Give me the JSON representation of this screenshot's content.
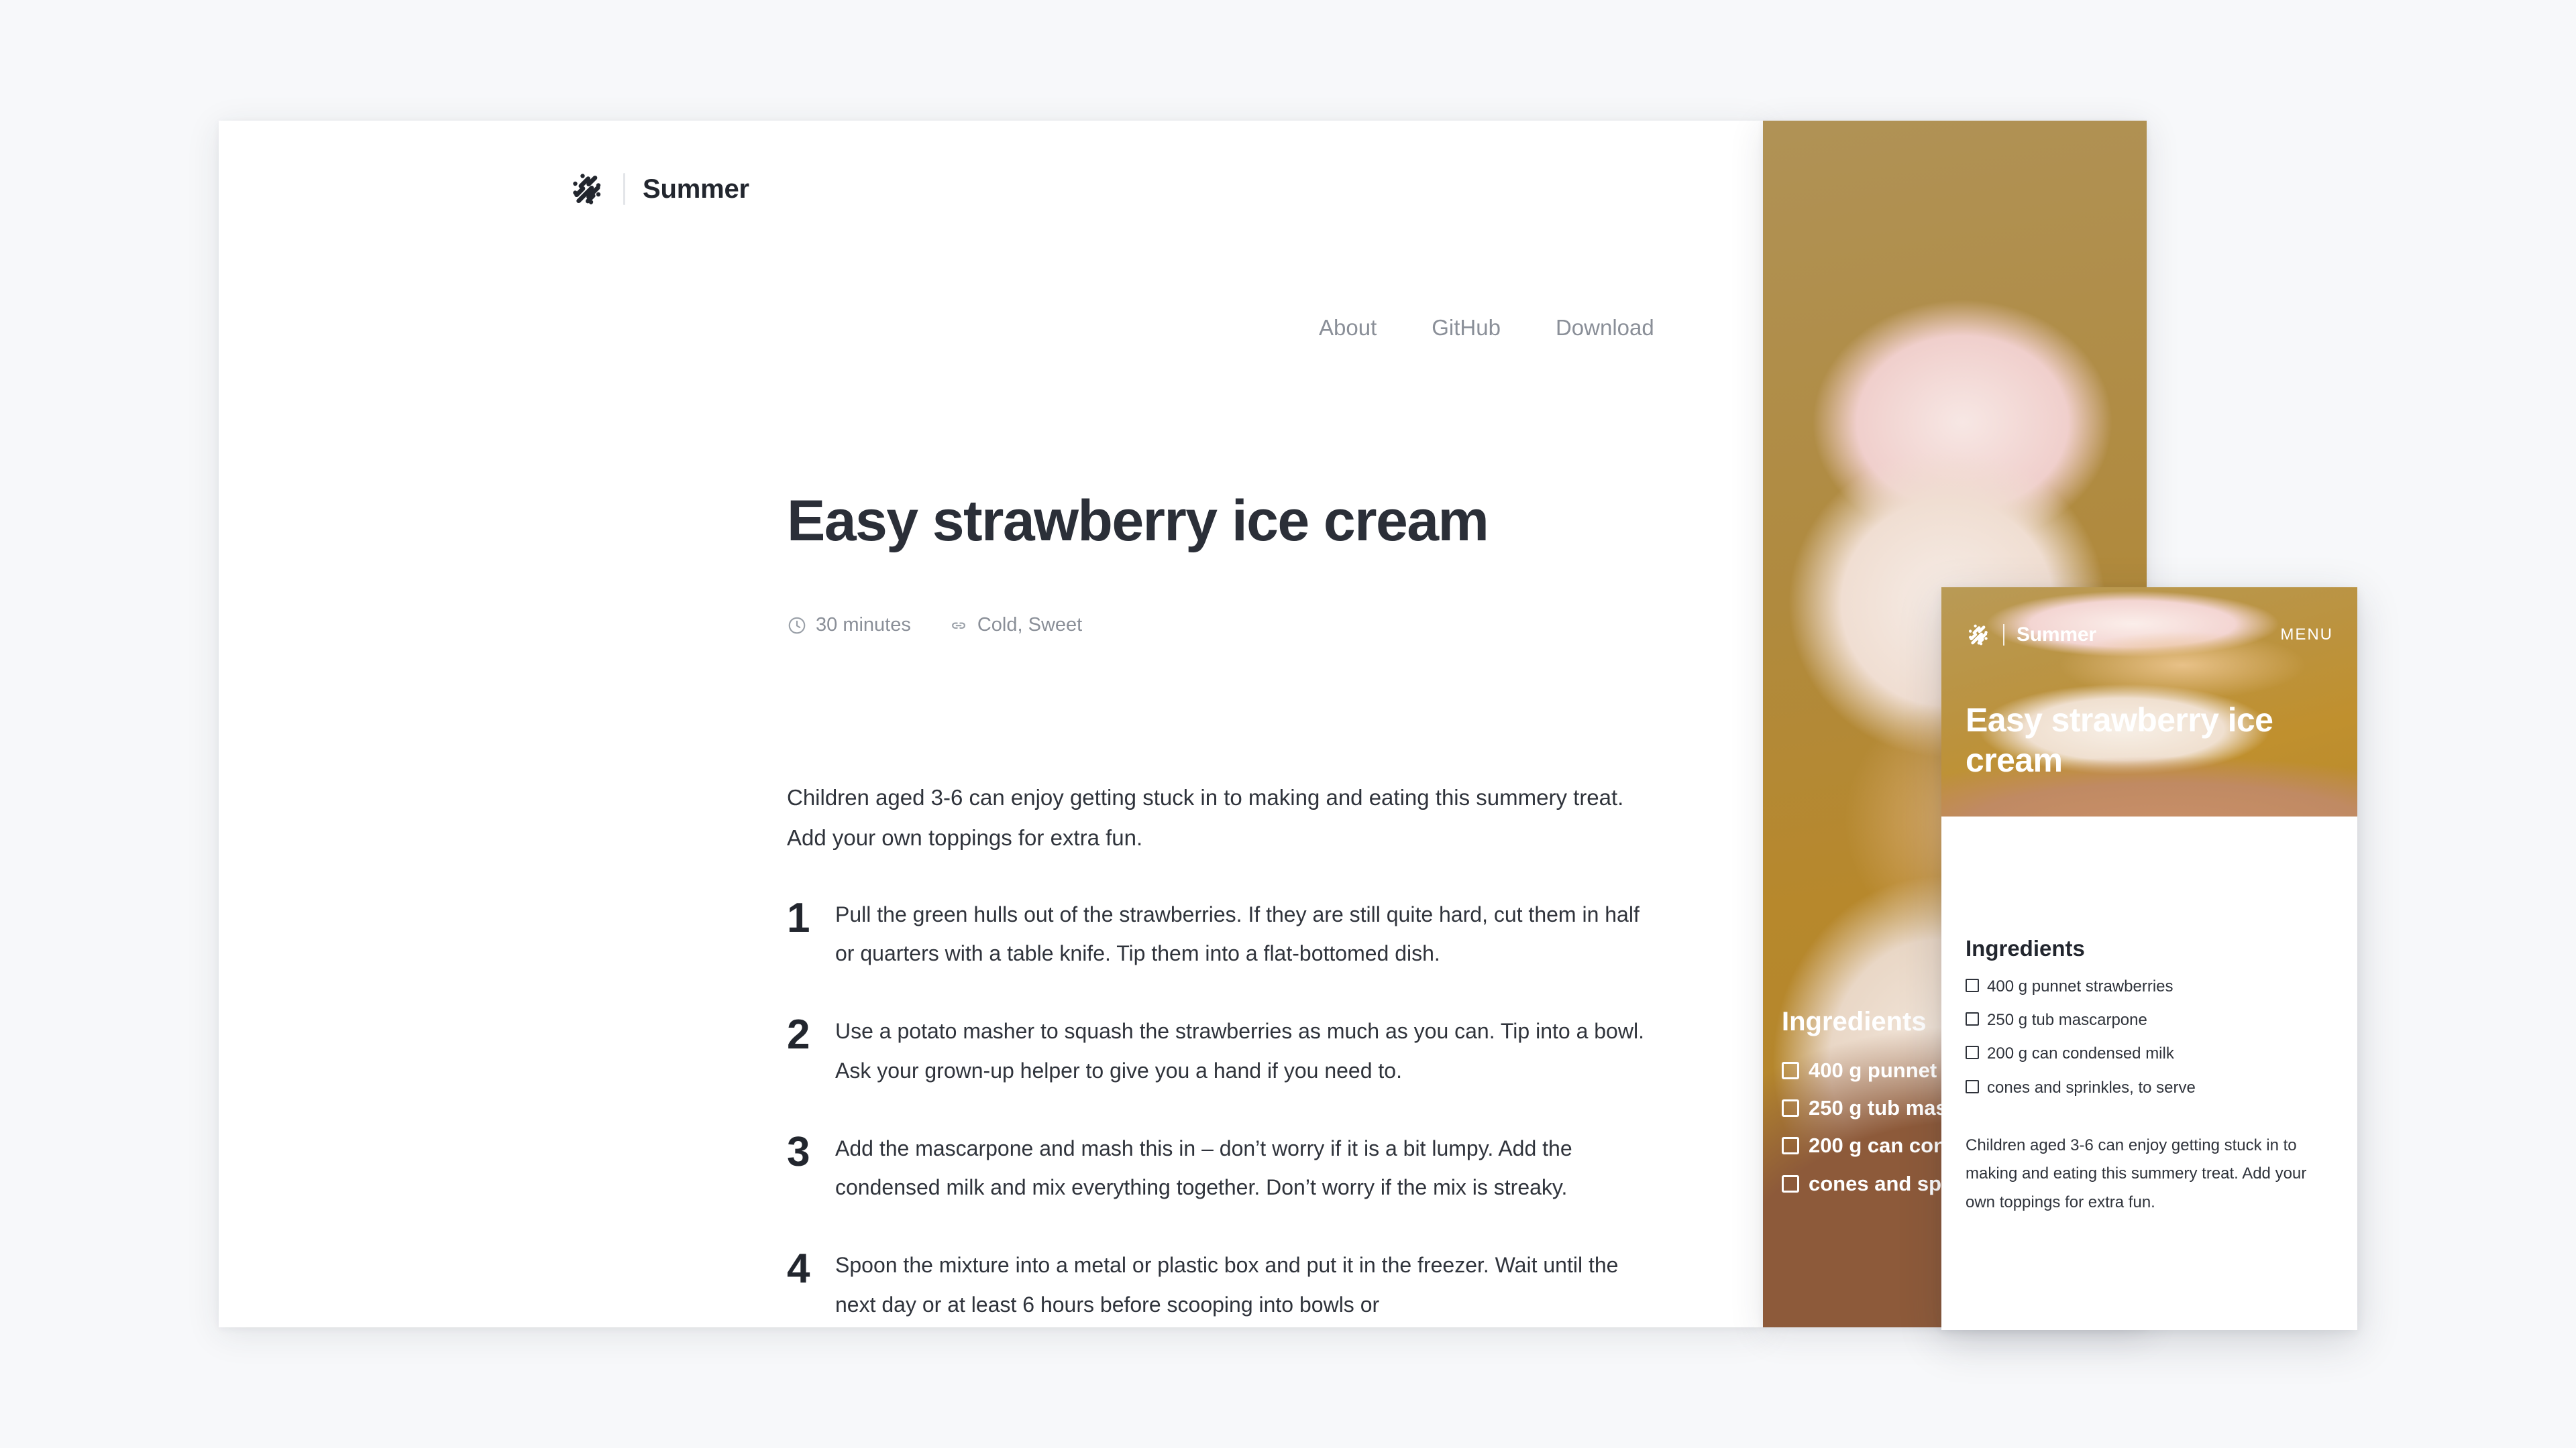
{
  "site": {
    "brand_name": "Summer",
    "logo_icon": "diagonal-dashes-circle-logo",
    "nav": [
      {
        "label": "About"
      },
      {
        "label": "GitHub"
      },
      {
        "label": "Download"
      }
    ],
    "mobile_menu_label": "MENU"
  },
  "recipe": {
    "title": "Easy strawberry ice cream",
    "title_mobile": "Easy strawberry ice cream",
    "meta": {
      "time_icon": "clock-icon",
      "time": "30 minutes",
      "tags_icon": "link-icon",
      "tags": "Cold, Sweet"
    },
    "intro": "Children aged 3-6 can enjoy getting stuck in to making and eating this summery treat. Add your own toppings for extra fun.",
    "ingredients_heading": "Ingredients",
    "ingredients": [
      "400 g punnet strawberries",
      "250 g tub mascarpone",
      "200 g can condensed milk",
      "cones and sprinkles, to serve"
    ],
    "steps": [
      {
        "number": "1",
        "text": "Pull the green hulls out of the strawberries. If they are still quite hard, cut them in half or quarters with a table knife. Tip them into a flat-bottomed dish."
      },
      {
        "number": "2",
        "text": "Use a potato masher to squash the strawberries as much as you can. Tip into a bowl. Ask your grown-up helper to give you a hand if you need to."
      },
      {
        "number": "3",
        "text": "Add the mascarpone and mash this in – don’t worry if it is a bit lumpy. Add the condensed milk and mix everything together. Don’t worry if the mix is streaky."
      },
      {
        "number": "4",
        "text": "Spoon the mixture into a metal or plastic box and put it in the freezer. Wait until the next day or at least 6 hours before scooping into bowls or"
      }
    ]
  },
  "colors": {
    "page_background": "#f7f8fa",
    "panel_background": "#ffffff",
    "text_primary": "#2f333b",
    "text_muted": "#8a8f98",
    "accent_gold": "#b0832e"
  }
}
